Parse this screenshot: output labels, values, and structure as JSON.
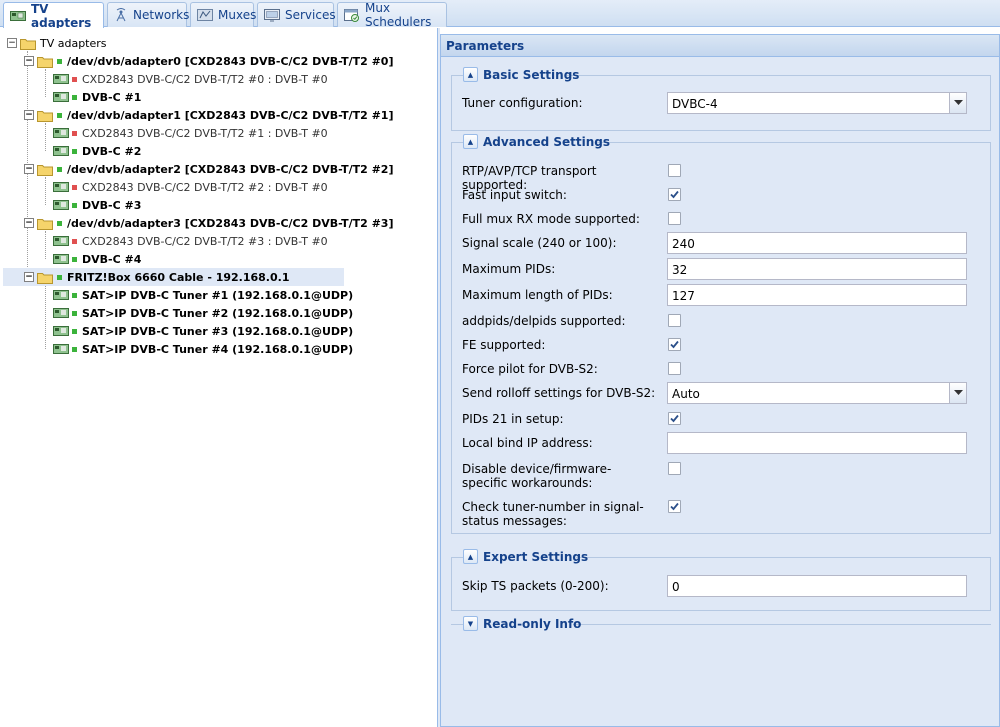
{
  "tabs": [
    {
      "label": "TV adapters",
      "icon": "tv-card-icon",
      "active": true
    },
    {
      "label": "Networks",
      "icon": "antenna-icon"
    },
    {
      "label": "Muxes",
      "icon": "muxes-icon"
    },
    {
      "label": "Services",
      "icon": "services-icon"
    },
    {
      "label": "Mux Schedulers",
      "icon": "scheduler-icon"
    }
  ],
  "tree": {
    "root": "TV adapters",
    "adapter0": "/dev/dvb/adapter0 [CXD2843 DVB-C/C2 DVB-T/T2 #0]",
    "adapter0_t": "CXD2843 DVB-C/C2 DVB-T/T2 #0 : DVB-T #0",
    "adapter0_c": "DVB-C #1",
    "adapter1": "/dev/dvb/adapter1 [CXD2843 DVB-C/C2 DVB-T/T2 #1]",
    "adapter1_t": "CXD2843 DVB-C/C2 DVB-T/T2 #1 : DVB-T #0",
    "adapter1_c": "DVB-C #2",
    "adapter2": "/dev/dvb/adapter2 [CXD2843 DVB-C/C2 DVB-T/T2 #2]",
    "adapter2_t": "CXD2843 DVB-C/C2 DVB-T/T2 #2 : DVB-T #0",
    "adapter2_c": "DVB-C #3",
    "adapter3": "/dev/dvb/adapter3 [CXD2843 DVB-C/C2 DVB-T/T2 #3]",
    "adapter3_t": "CXD2843 DVB-C/C2 DVB-T/T2 #3 : DVB-T #0",
    "adapter3_c": "DVB-C #4",
    "fritz": "FRITZ!Box 6660 Cable - 192.168.0.1",
    "satip1": "SAT>IP DVB-C Tuner #1 (192.168.0.1@UDP)",
    "satip2": "SAT>IP DVB-C Tuner #2 (192.168.0.1@UDP)",
    "satip3": "SAT>IP DVB-C Tuner #3 (192.168.0.1@UDP)",
    "satip4": "SAT>IP DVB-C Tuner #4 (192.168.0.1@UDP)"
  },
  "panel": {
    "title": "Parameters",
    "basic": {
      "legend": "Basic Settings",
      "tuner_label": "Tuner configuration:",
      "tuner_value": "DVBC-4"
    },
    "advanced": {
      "legend": "Advanced Settings",
      "rtp_label": "RTP/AVP/TCP transport supported:",
      "rtp_checked": false,
      "fast_label": "Fast input switch:",
      "fast_checked": true,
      "fullmux_label": "Full mux RX mode supported:",
      "fullmux_checked": false,
      "signal_label": "Signal scale (240 or 100):",
      "signal_value": "240",
      "maxpids_label": "Maximum PIDs:",
      "maxpids_value": "32",
      "maxlen_label": "Maximum length of PIDs:",
      "maxlen_value": "127",
      "addpids_label": "addpids/delpids supported:",
      "addpids_checked": false,
      "fe_label": "FE supported:",
      "fe_checked": true,
      "pilot_label": "Force pilot for DVB-S2:",
      "pilot_checked": false,
      "rolloff_label": "Send rolloff settings for DVB-S2:",
      "rolloff_value": "Auto",
      "pids21_label": "PIDs 21 in setup:",
      "pids21_checked": true,
      "bind_label": "Local bind IP address:",
      "bind_value": "",
      "disable_label": "Disable device/firmware-specific workarounds:",
      "disable_checked": false,
      "check_label": "Check tuner-number in signal-status messages:",
      "check_checked": true
    },
    "expert": {
      "legend": "Expert Settings",
      "skip_label": "Skip TS packets (0-200):",
      "skip_value": "0"
    },
    "readonly": {
      "legend": "Read-only Info"
    }
  }
}
